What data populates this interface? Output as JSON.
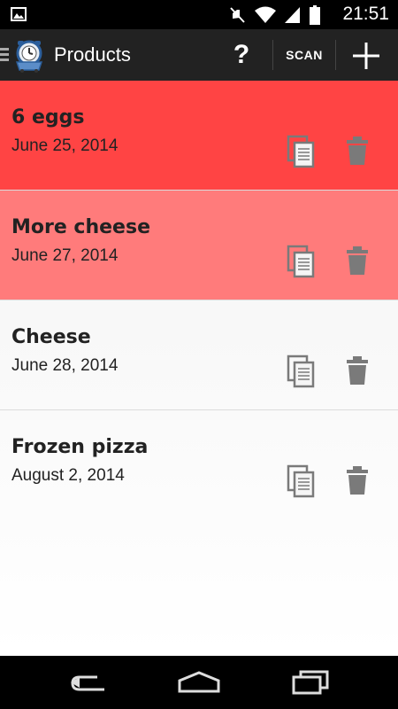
{
  "status_bar": {
    "time": "21:51",
    "icons": [
      "gallery-icon",
      "mute-icon",
      "wifi-icon",
      "signal-icon",
      "battery-icon"
    ]
  },
  "action_bar": {
    "title": "Products",
    "help_label": "?",
    "scan_label": "SCAN",
    "icons": [
      "app-logo-icon",
      "help-icon",
      "add-icon"
    ]
  },
  "products": [
    {
      "name": "6 eggs",
      "date": "June 25, 2014",
      "status": "expired",
      "color": "#ff4444"
    },
    {
      "name": "More cheese",
      "date": "June 27, 2014",
      "status": "expiring",
      "color": "#ff7b7b"
    },
    {
      "name": "Cheese",
      "date": "June 28, 2014",
      "status": "ok",
      "color": "transparent"
    },
    {
      "name": "Frozen pizza",
      "date": "August 2, 2014",
      "status": "ok",
      "color": "transparent"
    }
  ],
  "nav_bar": {
    "icons": [
      "back-icon",
      "home-icon",
      "recent-apps-icon"
    ]
  },
  "colors": {
    "action_bar": "#222222",
    "expired": "#ff4444",
    "expiring": "#ff7b7b",
    "icon_gray": "#7a7a7a"
  }
}
